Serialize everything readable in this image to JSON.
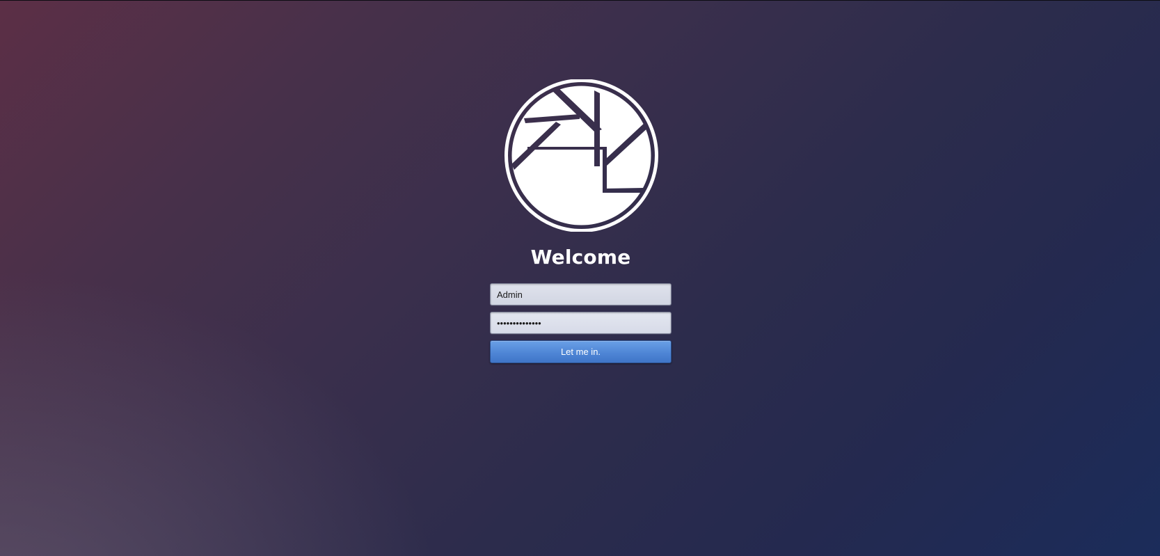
{
  "logo": {
    "icon": "camera-aperture-logo-icon",
    "fill_color": "#ffffff"
  },
  "heading": {
    "title": "Welcome"
  },
  "form": {
    "username_value": "Admin",
    "password_value": "••••••••••••••",
    "submit_label": "Let me in."
  },
  "colors": {
    "button": "#4f86d6",
    "background_start": "#5c2f46",
    "background_end": "#1b2c5a"
  }
}
